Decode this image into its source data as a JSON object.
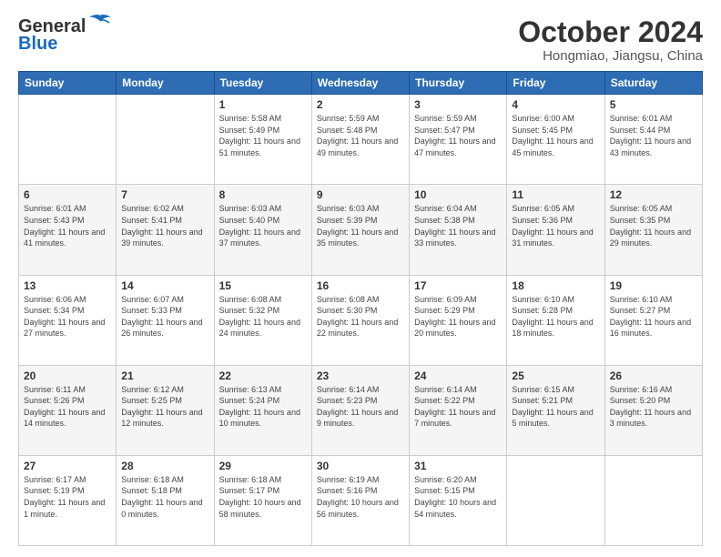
{
  "logo": {
    "line1": "General",
    "line2": "Blue"
  },
  "title": "October 2024",
  "subtitle": "Hongmiao, Jiangsu, China",
  "days_header": [
    "Sunday",
    "Monday",
    "Tuesday",
    "Wednesday",
    "Thursday",
    "Friday",
    "Saturday"
  ],
  "weeks": [
    [
      {
        "day": "",
        "info": ""
      },
      {
        "day": "",
        "info": ""
      },
      {
        "day": "1",
        "info": "Sunrise: 5:58 AM\nSunset: 5:49 PM\nDaylight: 11 hours and 51 minutes."
      },
      {
        "day": "2",
        "info": "Sunrise: 5:59 AM\nSunset: 5:48 PM\nDaylight: 11 hours and 49 minutes."
      },
      {
        "day": "3",
        "info": "Sunrise: 5:59 AM\nSunset: 5:47 PM\nDaylight: 11 hours and 47 minutes."
      },
      {
        "day": "4",
        "info": "Sunrise: 6:00 AM\nSunset: 5:45 PM\nDaylight: 11 hours and 45 minutes."
      },
      {
        "day": "5",
        "info": "Sunrise: 6:01 AM\nSunset: 5:44 PM\nDaylight: 11 hours and 43 minutes."
      }
    ],
    [
      {
        "day": "6",
        "info": "Sunrise: 6:01 AM\nSunset: 5:43 PM\nDaylight: 11 hours and 41 minutes."
      },
      {
        "day": "7",
        "info": "Sunrise: 6:02 AM\nSunset: 5:41 PM\nDaylight: 11 hours and 39 minutes."
      },
      {
        "day": "8",
        "info": "Sunrise: 6:03 AM\nSunset: 5:40 PM\nDaylight: 11 hours and 37 minutes."
      },
      {
        "day": "9",
        "info": "Sunrise: 6:03 AM\nSunset: 5:39 PM\nDaylight: 11 hours and 35 minutes."
      },
      {
        "day": "10",
        "info": "Sunrise: 6:04 AM\nSunset: 5:38 PM\nDaylight: 11 hours and 33 minutes."
      },
      {
        "day": "11",
        "info": "Sunrise: 6:05 AM\nSunset: 5:36 PM\nDaylight: 11 hours and 31 minutes."
      },
      {
        "day": "12",
        "info": "Sunrise: 6:05 AM\nSunset: 5:35 PM\nDaylight: 11 hours and 29 minutes."
      }
    ],
    [
      {
        "day": "13",
        "info": "Sunrise: 6:06 AM\nSunset: 5:34 PM\nDaylight: 11 hours and 27 minutes."
      },
      {
        "day": "14",
        "info": "Sunrise: 6:07 AM\nSunset: 5:33 PM\nDaylight: 11 hours and 26 minutes."
      },
      {
        "day": "15",
        "info": "Sunrise: 6:08 AM\nSunset: 5:32 PM\nDaylight: 11 hours and 24 minutes."
      },
      {
        "day": "16",
        "info": "Sunrise: 6:08 AM\nSunset: 5:30 PM\nDaylight: 11 hours and 22 minutes."
      },
      {
        "day": "17",
        "info": "Sunrise: 6:09 AM\nSunset: 5:29 PM\nDaylight: 11 hours and 20 minutes."
      },
      {
        "day": "18",
        "info": "Sunrise: 6:10 AM\nSunset: 5:28 PM\nDaylight: 11 hours and 18 minutes."
      },
      {
        "day": "19",
        "info": "Sunrise: 6:10 AM\nSunset: 5:27 PM\nDaylight: 11 hours and 16 minutes."
      }
    ],
    [
      {
        "day": "20",
        "info": "Sunrise: 6:11 AM\nSunset: 5:26 PM\nDaylight: 11 hours and 14 minutes."
      },
      {
        "day": "21",
        "info": "Sunrise: 6:12 AM\nSunset: 5:25 PM\nDaylight: 11 hours and 12 minutes."
      },
      {
        "day": "22",
        "info": "Sunrise: 6:13 AM\nSunset: 5:24 PM\nDaylight: 11 hours and 10 minutes."
      },
      {
        "day": "23",
        "info": "Sunrise: 6:14 AM\nSunset: 5:23 PM\nDaylight: 11 hours and 9 minutes."
      },
      {
        "day": "24",
        "info": "Sunrise: 6:14 AM\nSunset: 5:22 PM\nDaylight: 11 hours and 7 minutes."
      },
      {
        "day": "25",
        "info": "Sunrise: 6:15 AM\nSunset: 5:21 PM\nDaylight: 11 hours and 5 minutes."
      },
      {
        "day": "26",
        "info": "Sunrise: 6:16 AM\nSunset: 5:20 PM\nDaylight: 11 hours and 3 minutes."
      }
    ],
    [
      {
        "day": "27",
        "info": "Sunrise: 6:17 AM\nSunset: 5:19 PM\nDaylight: 11 hours and 1 minute."
      },
      {
        "day": "28",
        "info": "Sunrise: 6:18 AM\nSunset: 5:18 PM\nDaylight: 11 hours and 0 minutes."
      },
      {
        "day": "29",
        "info": "Sunrise: 6:18 AM\nSunset: 5:17 PM\nDaylight: 10 hours and 58 minutes."
      },
      {
        "day": "30",
        "info": "Sunrise: 6:19 AM\nSunset: 5:16 PM\nDaylight: 10 hours and 56 minutes."
      },
      {
        "day": "31",
        "info": "Sunrise: 6:20 AM\nSunset: 5:15 PM\nDaylight: 10 hours and 54 minutes."
      },
      {
        "day": "",
        "info": ""
      },
      {
        "day": "",
        "info": ""
      }
    ]
  ]
}
